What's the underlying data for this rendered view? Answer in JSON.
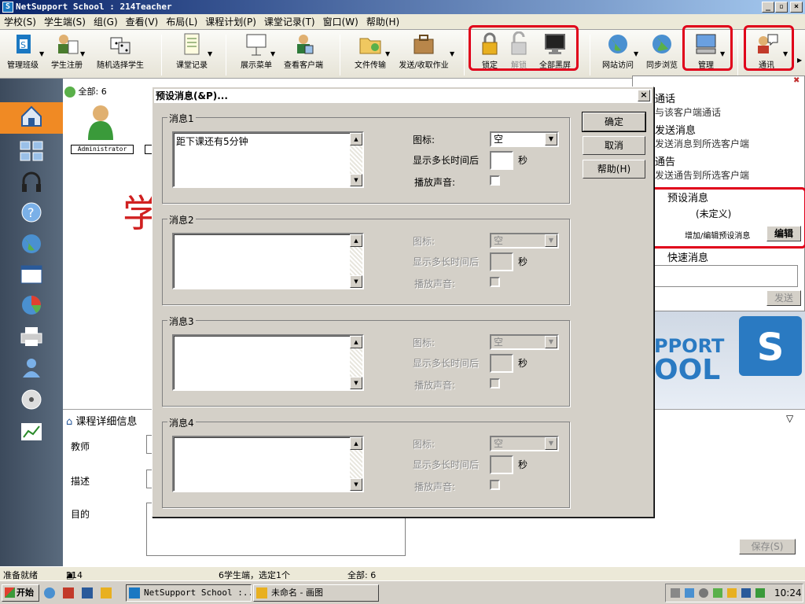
{
  "window": {
    "title": "NetSupport School : 214Teacher",
    "app_icon_glyph": "S",
    "min": "_",
    "max": "▫",
    "close": "×"
  },
  "menu": [
    "学校(S)",
    "学生端(S)",
    "组(G)",
    "查看(V)",
    "布局(L)",
    "课程计划(P)",
    "课堂记录(T)",
    "窗口(W)",
    "帮助(H)"
  ],
  "toolbar": [
    {
      "label": "管理班级",
      "icon": "class-icon"
    },
    {
      "label": "学生注册",
      "icon": "register-icon"
    },
    {
      "label": "随机选择学生",
      "icon": "dice-icon"
    },
    {
      "label": "课堂记录",
      "icon": "notes-icon"
    },
    {
      "label": "展示菜单",
      "icon": "show-icon"
    },
    {
      "label": "查看客户端",
      "icon": "view-client-icon"
    },
    {
      "label": "文件传输",
      "icon": "folder-icon"
    },
    {
      "label": "发送/收取作业",
      "icon": "briefcase-icon"
    },
    {
      "label": "锁定",
      "icon": "lock-icon"
    },
    {
      "label": "解锁",
      "icon": "unlock-icon"
    },
    {
      "label": "全部黑屏",
      "icon": "monitor-icon"
    },
    {
      "label": "网站访问",
      "icon": "globe-icon"
    },
    {
      "label": "同步浏览",
      "icon": "globe-sync-icon"
    },
    {
      "label": "管理",
      "icon": "manage-icon"
    },
    {
      "label": "通讯",
      "icon": "chat-icon"
    }
  ],
  "student_tab": {
    "label": "全部: 6",
    "student_name": "Administrator"
  },
  "details": {
    "title": "课程详细信息",
    "teacher_label": "教师",
    "desc_label": "描述",
    "goal_label": "目的",
    "save_label": "保存(S)"
  },
  "right_panel": {
    "items": [
      {
        "title": "通话",
        "desc": "与该客户端通话"
      },
      {
        "title": "发送消息",
        "desc": "发送消息到所选客户端"
      },
      {
        "title": "通告",
        "desc": "发送通告到所选客户端"
      }
    ],
    "preset_title": "预设消息",
    "preset_value": "(未定义)",
    "preset_edit_hint": "增加/编辑预设消息",
    "edit_button": "编辑",
    "quick_title": "快速消息",
    "send_button": "发送",
    "logo_line1": "PPORT",
    "logo_line2": "OOL",
    "logo_mark": "S"
  },
  "dialog": {
    "title": "预设消息(&P)...",
    "close": "×",
    "ok": "确定",
    "cancel": "取消",
    "help": "帮助(H)",
    "icon_label": "图标:",
    "delay_label": "显示多长时间后",
    "seconds": "秒",
    "sound_label": "播放声音:",
    "groups": [
      {
        "label": "消息1",
        "text": "距下课还有5分钟",
        "icon_value": "空",
        "enabled": true
      },
      {
        "label": "消息2",
        "text": "",
        "icon_value": "空",
        "enabled": false
      },
      {
        "label": "消息3",
        "text": "",
        "icon_value": "空",
        "enabled": false
      },
      {
        "label": "消息4",
        "text": "",
        "icon_value": "空",
        "enabled": false
      }
    ]
  },
  "statusbar": {
    "ready": "准备就绪",
    "host": "214",
    "selected": "6学生端，选定1个",
    "all": "全部: 6"
  },
  "taskbar": {
    "start": "开始",
    "tasks": [
      "NetSupport School :...",
      "未命名 - 画图"
    ],
    "time": "10:24"
  },
  "big_char": "学"
}
